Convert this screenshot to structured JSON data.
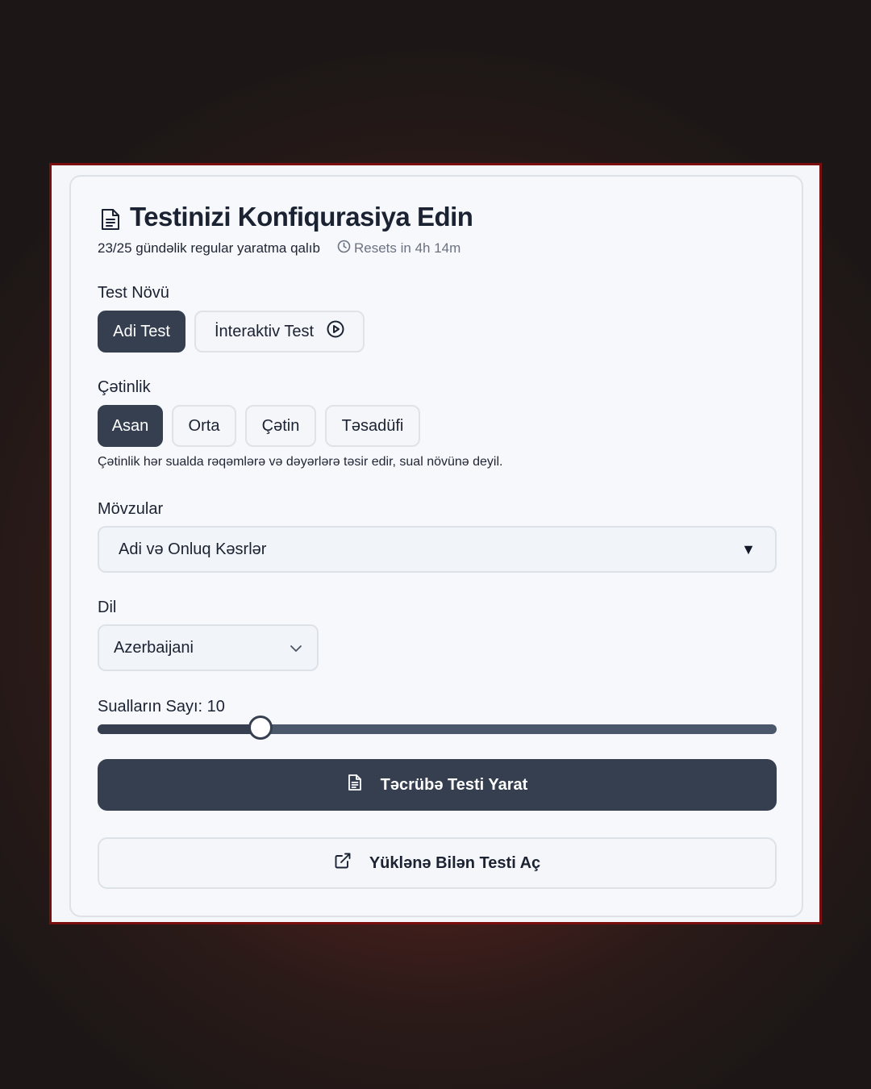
{
  "header": {
    "title": "Testinizi Konfiqurasiya Edin",
    "title_icon": "document-icon",
    "quota_text": "23/25 gündəlik regular yaratma qalıb",
    "reset_text": "Resets in 4h 14m",
    "reset_icon": "clock-icon"
  },
  "test_type": {
    "label": "Test Növü",
    "options": [
      "Adi Test",
      "İnteraktiv Test"
    ],
    "selected": "Adi Test",
    "interactive_icon": "play-circle-icon"
  },
  "difficulty": {
    "label": "Çətinlik",
    "options": [
      "Asan",
      "Orta",
      "Çətin",
      "Təsadüfi"
    ],
    "selected": "Asan",
    "hint": "Çətinlik hər sualda rəqəmlərə və dəyərlərə təsir edir, sual növünə deyil."
  },
  "topics": {
    "label": "Mövzular",
    "value": "Adi və Onluq Kəsrlər",
    "arrow": "▼"
  },
  "language": {
    "label": "Dil",
    "value": "Azerbaijani",
    "chevron_icon": "chevron-down-icon"
  },
  "question_count": {
    "label": "Sualların Sayı: 10",
    "value": 10,
    "fill_fraction": 0.24
  },
  "actions": {
    "generate_label": "Təcrübə Testi Yarat",
    "generate_icon": "document-icon",
    "open_label": "Yüklənə Bilən Testi Aç",
    "open_icon": "external-link-icon"
  },
  "colors": {
    "accent": "#353f4f",
    "frame_border": "#7a0d0d",
    "card_bg": "#f6f8fb"
  }
}
